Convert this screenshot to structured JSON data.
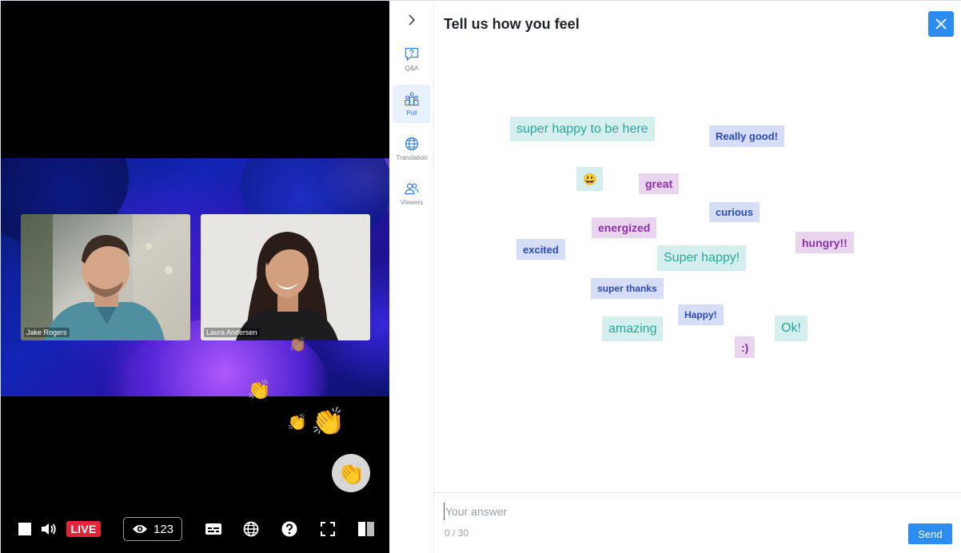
{
  "video": {
    "participants": [
      {
        "name": "Jake Rogers"
      },
      {
        "name": "Laura Andersen"
      }
    ],
    "reactions": [
      "👏",
      "👏",
      "👏",
      "👏"
    ],
    "reaction_button_emoji": "👏"
  },
  "controls": {
    "live_label": "LIVE",
    "viewer_count": "123"
  },
  "rail": {
    "items": [
      {
        "label": "Q&A",
        "icon": "qa-icon"
      },
      {
        "label": "Poll",
        "icon": "poll-icon",
        "active": true
      },
      {
        "label": "Translation",
        "icon": "globe-icon"
      },
      {
        "label": "Viewers",
        "icon": "users-icon"
      }
    ]
  },
  "panel": {
    "title": "Tell us how you feel",
    "words": [
      {
        "text": "super happy to be here",
        "color": "teal"
      },
      {
        "text": "Really good!",
        "color": "blue"
      },
      {
        "text": "😃",
        "color": "teal"
      },
      {
        "text": "great",
        "color": "purple"
      },
      {
        "text": "curious",
        "color": "blue"
      },
      {
        "text": "energized",
        "color": "purple"
      },
      {
        "text": "hungry!!",
        "color": "purple"
      },
      {
        "text": "excited",
        "color": "blue"
      },
      {
        "text": "Super happy!",
        "color": "teal"
      },
      {
        "text": "super thanks",
        "color": "blue"
      },
      {
        "text": "Happy!",
        "color": "blue"
      },
      {
        "text": "amazing",
        "color": "teal"
      },
      {
        "text": "Ok!",
        "color": "teal"
      },
      {
        "text": ":)",
        "color": "purple"
      }
    ],
    "answer": {
      "placeholder": "Your answer",
      "value": "",
      "char_count": "0 / 30"
    },
    "send_label": "Send"
  },
  "colors": {
    "accent": "#2d8cf0",
    "live": "#e4243b",
    "word_teal": "#28a79a",
    "word_blue": "#2e4ab8",
    "word_purple": "#8a31a8"
  }
}
